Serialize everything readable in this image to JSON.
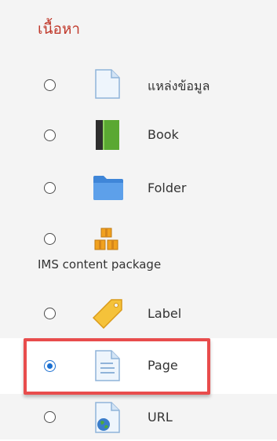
{
  "section": {
    "title": "เนื้อหา"
  },
  "items": [
    {
      "label": "แหล่งข้อมูล",
      "icon": "file-icon",
      "selected": false
    },
    {
      "label": "Book",
      "icon": "book-icon",
      "selected": false
    },
    {
      "label": "Folder",
      "icon": "folder-icon",
      "selected": false
    },
    {
      "label": "IMS content package",
      "icon": "package-icon",
      "selected": false
    },
    {
      "label": "Label",
      "icon": "tag-icon",
      "selected": false
    },
    {
      "label": "Page",
      "icon": "page-icon",
      "selected": true
    },
    {
      "label": "URL",
      "icon": "url-globe-icon",
      "selected": false
    }
  ],
  "colors": {
    "title": "#c0392b",
    "highlight_border": "#e84c4c",
    "radio_selected": "#1a6fd1",
    "panel_bg": "#f4f4f4"
  }
}
